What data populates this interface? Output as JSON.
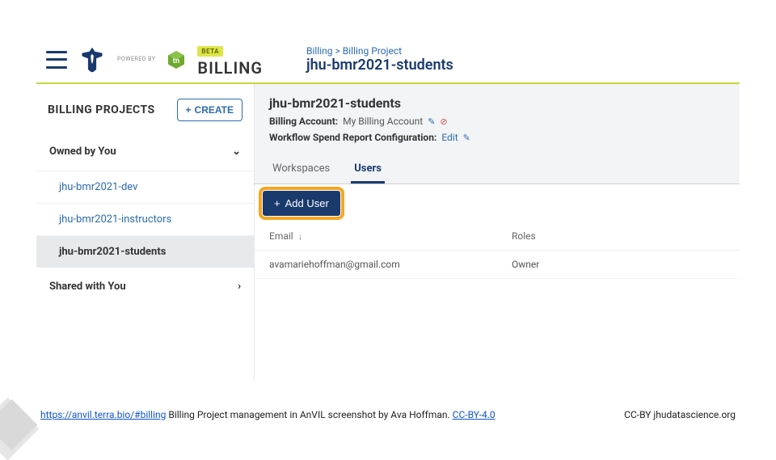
{
  "header": {
    "powered": "POWERED BY",
    "beta": "BETA",
    "billing": "BILLING",
    "breadcrumb_root": "Billing",
    "breadcrumb_sep": " > ",
    "breadcrumb_leaf": "Billing Project",
    "page_title": "jhu-bmr2021-students"
  },
  "sidebar": {
    "title": "BILLING PROJECTS",
    "create_label": "CREATE",
    "owned_label": "Owned by You",
    "shared_label": "Shared with You",
    "projects": [
      {
        "label": "jhu-bmr2021-dev"
      },
      {
        "label": "jhu-bmr2021-instructors"
      },
      {
        "label": "jhu-bmr2021-students"
      }
    ]
  },
  "main": {
    "project_name": "jhu-bmr2021-students",
    "billing_account_label": "Billing Account:",
    "billing_account_value": "My Billing Account",
    "workflow_label": "Workflow Spend Report Configuration:",
    "workflow_value": "Edit",
    "tabs": [
      {
        "label": "Workspaces"
      },
      {
        "label": "Users"
      }
    ],
    "add_user_label": "Add User",
    "columns": {
      "email": "Email",
      "roles": "Roles"
    },
    "rows": [
      {
        "email": "avamariehoffman@gmail.com",
        "role": "Owner"
      }
    ]
  },
  "footer": {
    "url": "https://anvil.terra.bio/#billing",
    "desc": " Billing Project management in AnVIL screenshot by Ava Hoffman. ",
    "license": "CC-BY-4.0",
    "right": "CC-BY  jhudatascience.org"
  }
}
